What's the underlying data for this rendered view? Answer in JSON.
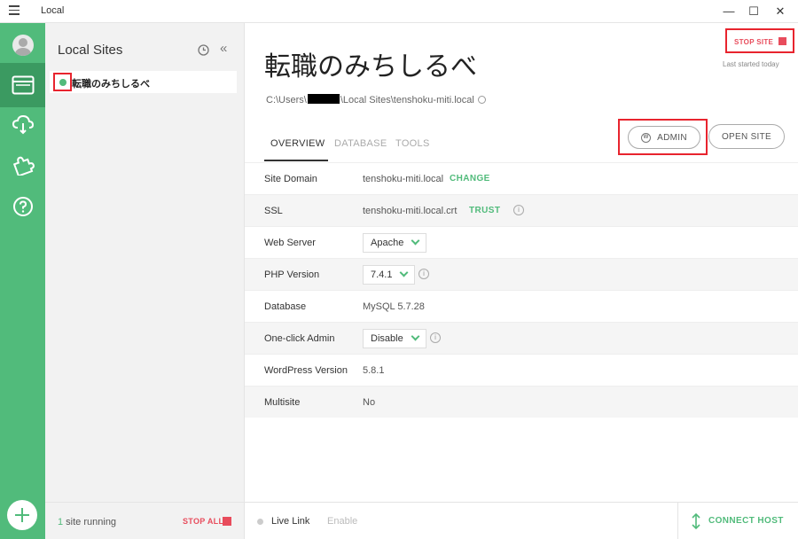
{
  "window": {
    "title": "Local",
    "controls": {
      "minimize": "—",
      "maximize": "☐",
      "close": "✕"
    }
  },
  "rail": {
    "items": [
      {
        "name": "avatar"
      },
      {
        "name": "sites-icon"
      },
      {
        "name": "cloud-icon"
      },
      {
        "name": "puzzle-icon"
      },
      {
        "name": "help-icon"
      }
    ],
    "add_label": "+"
  },
  "sites_panel": {
    "heading": "Local Sites",
    "collapse": "«",
    "items": [
      {
        "name": "転職のみちしるべ",
        "status": "running"
      }
    ],
    "footer": {
      "count": "1",
      "running_suffix": " site running",
      "stop_all": "STOP ALL"
    }
  },
  "site": {
    "title": "転職のみちしるべ",
    "path_prefix": "C:\\Users\\",
    "path_suffix": "\\Local Sites\\tenshoku-miti.local",
    "stop_label": "STOP SITE",
    "last_started": "Last started today",
    "admin_label": "ADMIN",
    "open_label": "OPEN SITE",
    "tabs": [
      {
        "label": "OVERVIEW",
        "active": true
      },
      {
        "label": "DATABASE",
        "active": false
      },
      {
        "label": "TOOLS",
        "active": false
      }
    ],
    "overview": {
      "site_domain": {
        "label": "Site Domain",
        "value": "tenshoku-miti.local",
        "action": "CHANGE"
      },
      "ssl": {
        "label": "SSL",
        "value": "tenshoku-miti.local.crt",
        "action": "TRUST"
      },
      "web_server": {
        "label": "Web Server",
        "value": "Apache"
      },
      "php_version": {
        "label": "PHP Version",
        "value": "7.4.1"
      },
      "database": {
        "label": "Database",
        "value": "MySQL 5.7.28"
      },
      "one_click_admin": {
        "label": "One-click Admin",
        "value": "Disable"
      },
      "wordpress_version": {
        "label": "WordPress Version",
        "value": "5.8.1"
      },
      "multisite": {
        "label": "Multisite",
        "value": "No"
      }
    }
  },
  "footer": {
    "live_link": "Live Link",
    "enable": "Enable",
    "connect_host": "CONNECT HOST"
  },
  "colors": {
    "brand_green": "#51bb7b",
    "rail_active": "#3b9a61",
    "stop_red": "#e84c5c",
    "highlight_red": "#e8242e"
  }
}
